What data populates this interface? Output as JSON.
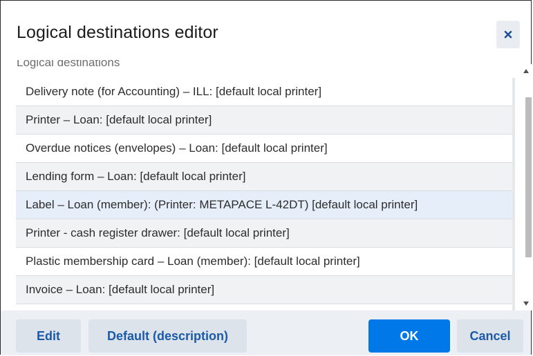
{
  "dialog": {
    "title": "Logical destinations editor",
    "close_icon": "close-icon"
  },
  "list": {
    "label": "Logical destinations",
    "items": [
      "Delivery note (for Accounting) – ILL: [default local printer]",
      "Printer – Loan: [default local printer]",
      "Overdue notices (envelopes) – Loan: [default local printer]",
      "Lending form – Loan: [default local printer]",
      "Label – Loan (member): (Printer: METAPACE L-42DT) [default local printer]",
      "Printer - cash register drawer: [default local printer]",
      "Plastic membership card – Loan (member): [default local printer]",
      "Invoice – Loan: [default local printer]"
    ],
    "selected_index": 4
  },
  "footer": {
    "edit_label": "Edit",
    "default_label": "Default (description)",
    "ok_label": "OK",
    "cancel_label": "Cancel"
  },
  "colors": {
    "primary": "#0078e7",
    "secondary_text": "#1b5aa6",
    "selected_row": "#e6eff9"
  }
}
